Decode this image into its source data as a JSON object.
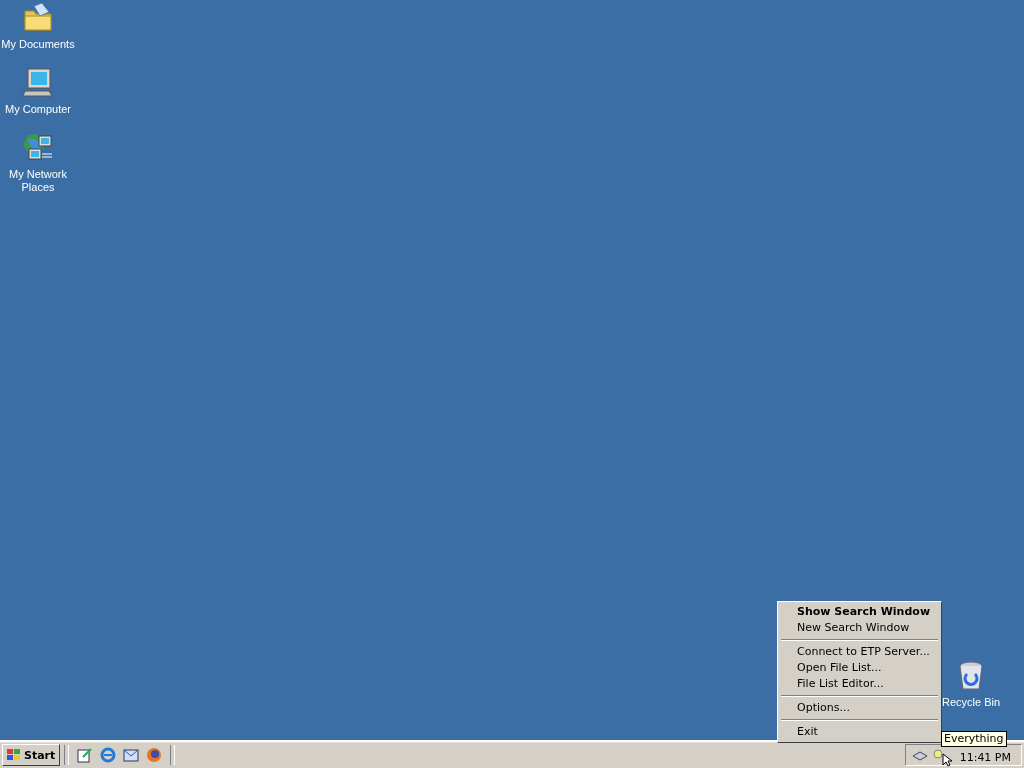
{
  "desktop_icons": [
    {
      "kind": "documents",
      "label": "My Documents"
    },
    {
      "kind": "computer",
      "label": "My Computer"
    },
    {
      "kind": "network",
      "label": "My Network Places"
    },
    {
      "kind": "recycle",
      "label": "Recycle Bin"
    }
  ],
  "context_menu": [
    {
      "kind": "item",
      "label": "Show Search Window",
      "default": true
    },
    {
      "kind": "item",
      "label": "New Search Window",
      "default": false
    },
    {
      "kind": "separator"
    },
    {
      "kind": "item",
      "label": "Connect to ETP Server...",
      "default": false
    },
    {
      "kind": "item",
      "label": "Open File List...",
      "default": false
    },
    {
      "kind": "item",
      "label": "File List Editor...",
      "default": false
    },
    {
      "kind": "separator"
    },
    {
      "kind": "item",
      "label": "Options...",
      "default": false
    },
    {
      "kind": "separator"
    },
    {
      "kind": "item",
      "label": "Exit",
      "default": false
    }
  ],
  "tooltip": "Everything",
  "taskbar": {
    "start_label": "Start",
    "quick_launch": [
      {
        "kind": "notepad"
      },
      {
        "kind": "ie"
      },
      {
        "kind": "mail"
      },
      {
        "kind": "firefox"
      }
    ],
    "clock": "11:41 PM"
  }
}
